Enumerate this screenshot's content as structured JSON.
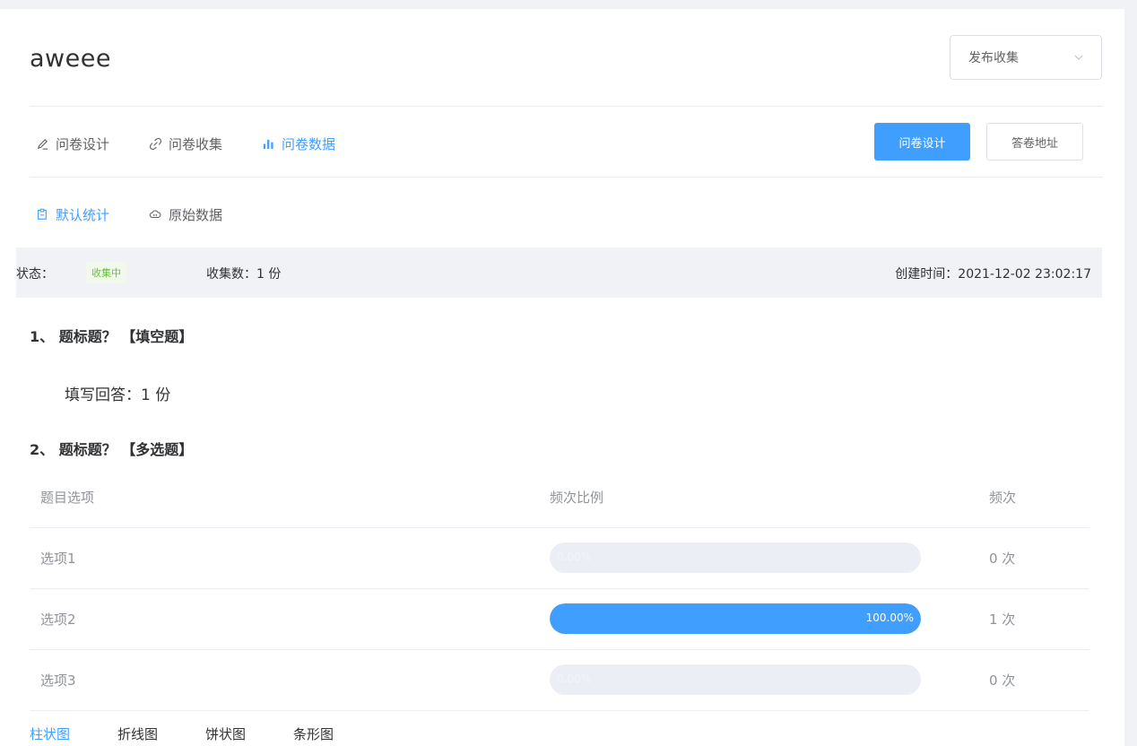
{
  "survey": {
    "title": "aweee"
  },
  "publish_select": {
    "value": "发布收集"
  },
  "nav": {
    "items": [
      {
        "label": "问卷设计",
        "icon": "pencil-icon",
        "active": false
      },
      {
        "label": "问卷收集",
        "icon": "link-icon",
        "active": false
      },
      {
        "label": "问卷数据",
        "icon": "bar-chart-icon",
        "active": true
      }
    ]
  },
  "actions": {
    "design_label": "问卷设计",
    "address_label": "答卷地址"
  },
  "subnav": {
    "items": [
      {
        "label": "默认统计",
        "icon": "clipboard-icon",
        "active": true
      },
      {
        "label": "原始数据",
        "icon": "cloud-icon",
        "active": false
      }
    ]
  },
  "status": {
    "label": "状态：",
    "badge": "收集中",
    "count_text": "收集数：1 份",
    "created_text": "创建时间：2021-12-02 23:02:17"
  },
  "questions": [
    {
      "title": "1、 题标题？ 【填空题】",
      "answer_text": "填写回答：1 份"
    },
    {
      "title": "2、 题标题？ 【多选题】"
    }
  ],
  "stats_table": {
    "headers": [
      "题目选项",
      "频次比例",
      "频次"
    ],
    "rows": [
      {
        "option": "选项1",
        "ratio": 0,
        "ratio_text": "0.00%",
        "count": "0 次"
      },
      {
        "option": "选项2",
        "ratio": 100,
        "ratio_text": "100.00%",
        "count": "1 次"
      },
      {
        "option": "选项3",
        "ratio": 0,
        "ratio_text": "0.00%",
        "count": "0 次"
      }
    ]
  },
  "chart_tabs": [
    {
      "label": "柱状图",
      "active": true
    },
    {
      "label": "折线图",
      "active": false
    },
    {
      "label": "饼状图",
      "active": false
    },
    {
      "label": "条形图",
      "active": false
    }
  ],
  "colors": {
    "primary": "#409eff",
    "success": "#67c23a",
    "bar_track": "#ebeef5"
  }
}
